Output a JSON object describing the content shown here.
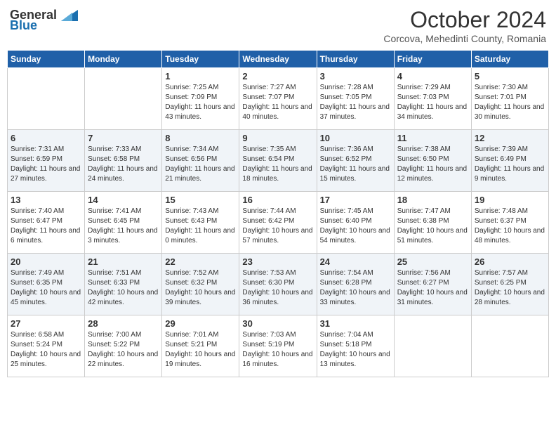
{
  "header": {
    "logo_general": "General",
    "logo_blue": "Blue",
    "month": "October 2024",
    "location": "Corcova, Mehedinti County, Romania"
  },
  "days_of_week": [
    "Sunday",
    "Monday",
    "Tuesday",
    "Wednesday",
    "Thursday",
    "Friday",
    "Saturday"
  ],
  "weeks": [
    [
      {
        "day": "",
        "content": ""
      },
      {
        "day": "",
        "content": ""
      },
      {
        "day": "1",
        "content": "Sunrise: 7:25 AM\nSunset: 7:09 PM\nDaylight: 11 hours and 43 minutes."
      },
      {
        "day": "2",
        "content": "Sunrise: 7:27 AM\nSunset: 7:07 PM\nDaylight: 11 hours and 40 minutes."
      },
      {
        "day": "3",
        "content": "Sunrise: 7:28 AM\nSunset: 7:05 PM\nDaylight: 11 hours and 37 minutes."
      },
      {
        "day": "4",
        "content": "Sunrise: 7:29 AM\nSunset: 7:03 PM\nDaylight: 11 hours and 34 minutes."
      },
      {
        "day": "5",
        "content": "Sunrise: 7:30 AM\nSunset: 7:01 PM\nDaylight: 11 hours and 30 minutes."
      }
    ],
    [
      {
        "day": "6",
        "content": "Sunrise: 7:31 AM\nSunset: 6:59 PM\nDaylight: 11 hours and 27 minutes."
      },
      {
        "day": "7",
        "content": "Sunrise: 7:33 AM\nSunset: 6:58 PM\nDaylight: 11 hours and 24 minutes."
      },
      {
        "day": "8",
        "content": "Sunrise: 7:34 AM\nSunset: 6:56 PM\nDaylight: 11 hours and 21 minutes."
      },
      {
        "day": "9",
        "content": "Sunrise: 7:35 AM\nSunset: 6:54 PM\nDaylight: 11 hours and 18 minutes."
      },
      {
        "day": "10",
        "content": "Sunrise: 7:36 AM\nSunset: 6:52 PM\nDaylight: 11 hours and 15 minutes."
      },
      {
        "day": "11",
        "content": "Sunrise: 7:38 AM\nSunset: 6:50 PM\nDaylight: 11 hours and 12 minutes."
      },
      {
        "day": "12",
        "content": "Sunrise: 7:39 AM\nSunset: 6:49 PM\nDaylight: 11 hours and 9 minutes."
      }
    ],
    [
      {
        "day": "13",
        "content": "Sunrise: 7:40 AM\nSunset: 6:47 PM\nDaylight: 11 hours and 6 minutes."
      },
      {
        "day": "14",
        "content": "Sunrise: 7:41 AM\nSunset: 6:45 PM\nDaylight: 11 hours and 3 minutes."
      },
      {
        "day": "15",
        "content": "Sunrise: 7:43 AM\nSunset: 6:43 PM\nDaylight: 11 hours and 0 minutes."
      },
      {
        "day": "16",
        "content": "Sunrise: 7:44 AM\nSunset: 6:42 PM\nDaylight: 10 hours and 57 minutes."
      },
      {
        "day": "17",
        "content": "Sunrise: 7:45 AM\nSunset: 6:40 PM\nDaylight: 10 hours and 54 minutes."
      },
      {
        "day": "18",
        "content": "Sunrise: 7:47 AM\nSunset: 6:38 PM\nDaylight: 10 hours and 51 minutes."
      },
      {
        "day": "19",
        "content": "Sunrise: 7:48 AM\nSunset: 6:37 PM\nDaylight: 10 hours and 48 minutes."
      }
    ],
    [
      {
        "day": "20",
        "content": "Sunrise: 7:49 AM\nSunset: 6:35 PM\nDaylight: 10 hours and 45 minutes."
      },
      {
        "day": "21",
        "content": "Sunrise: 7:51 AM\nSunset: 6:33 PM\nDaylight: 10 hours and 42 minutes."
      },
      {
        "day": "22",
        "content": "Sunrise: 7:52 AM\nSunset: 6:32 PM\nDaylight: 10 hours and 39 minutes."
      },
      {
        "day": "23",
        "content": "Sunrise: 7:53 AM\nSunset: 6:30 PM\nDaylight: 10 hours and 36 minutes."
      },
      {
        "day": "24",
        "content": "Sunrise: 7:54 AM\nSunset: 6:28 PM\nDaylight: 10 hours and 33 minutes."
      },
      {
        "day": "25",
        "content": "Sunrise: 7:56 AM\nSunset: 6:27 PM\nDaylight: 10 hours and 31 minutes."
      },
      {
        "day": "26",
        "content": "Sunrise: 7:57 AM\nSunset: 6:25 PM\nDaylight: 10 hours and 28 minutes."
      }
    ],
    [
      {
        "day": "27",
        "content": "Sunrise: 6:58 AM\nSunset: 5:24 PM\nDaylight: 10 hours and 25 minutes."
      },
      {
        "day": "28",
        "content": "Sunrise: 7:00 AM\nSunset: 5:22 PM\nDaylight: 10 hours and 22 minutes."
      },
      {
        "day": "29",
        "content": "Sunrise: 7:01 AM\nSunset: 5:21 PM\nDaylight: 10 hours and 19 minutes."
      },
      {
        "day": "30",
        "content": "Sunrise: 7:03 AM\nSunset: 5:19 PM\nDaylight: 10 hours and 16 minutes."
      },
      {
        "day": "31",
        "content": "Sunrise: 7:04 AM\nSunset: 5:18 PM\nDaylight: 10 hours and 13 minutes."
      },
      {
        "day": "",
        "content": ""
      },
      {
        "day": "",
        "content": ""
      }
    ]
  ]
}
